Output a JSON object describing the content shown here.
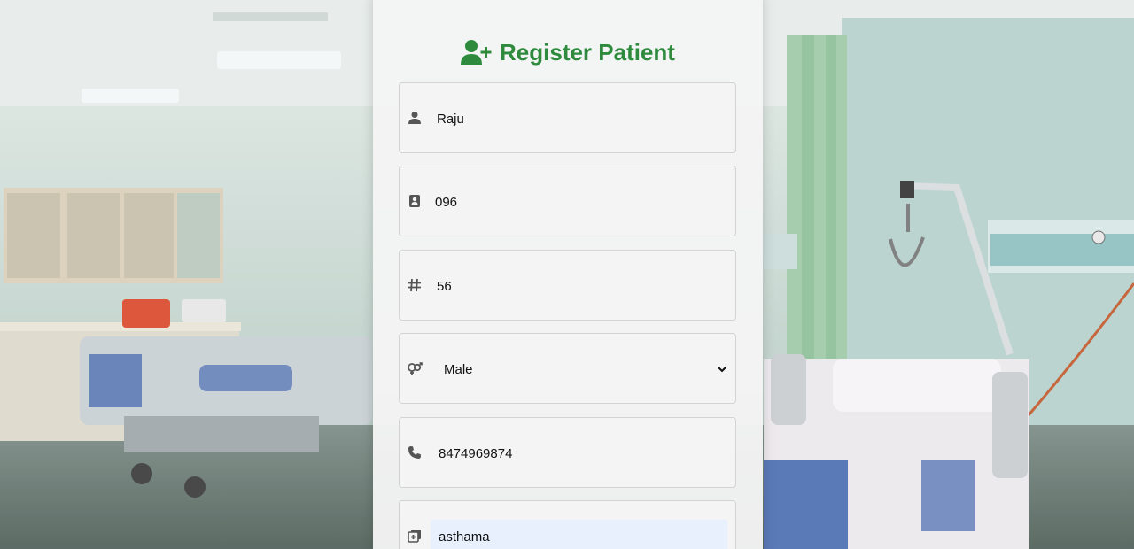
{
  "colors": {
    "accent": "#2e8b3e",
    "icon": "#555555",
    "autofill": "#e8f0fe"
  },
  "form": {
    "title": "Register Patient",
    "title_icon": "user-plus-icon",
    "fields": [
      {
        "icon": "user-icon",
        "value": "Raju"
      },
      {
        "icon": "id-card-icon",
        "value": "096"
      },
      {
        "icon": "hashtag-icon",
        "value": "56"
      },
      {
        "icon": "venus-mars-icon",
        "value": "Male"
      },
      {
        "icon": "phone-icon",
        "value": "8474969874"
      },
      {
        "icon": "notes-medical-icon",
        "value": "asthama"
      }
    ]
  }
}
